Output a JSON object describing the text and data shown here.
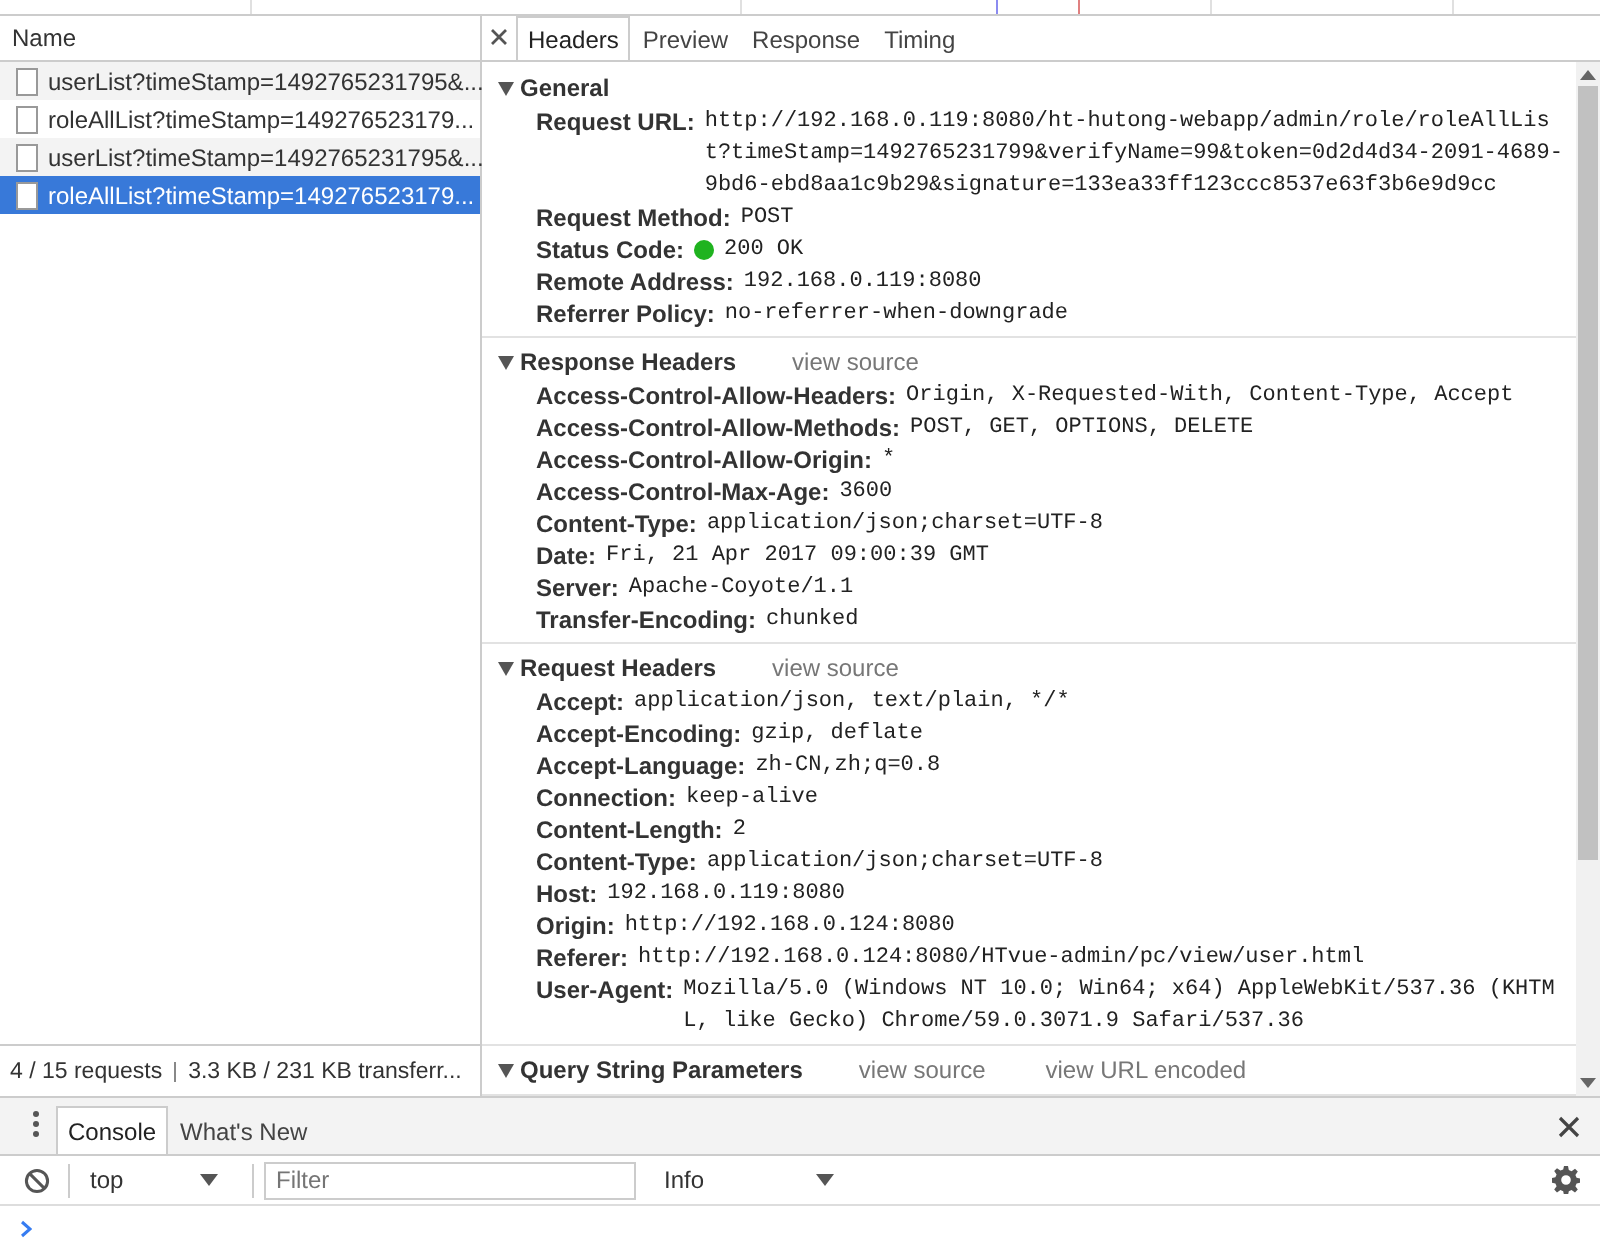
{
  "requests": {
    "column": "Name",
    "items": [
      {
        "label": "userList?timeStamp=1492765231795&...",
        "selected": false
      },
      {
        "label": "roleAllList?timeStamp=149276523179...",
        "selected": false
      },
      {
        "label": "userList?timeStamp=1492765231795&...",
        "selected": false
      },
      {
        "label": "roleAllList?timeStamp=149276523179...",
        "selected": true
      }
    ],
    "summary": {
      "requests": "4 / 15 requests",
      "transferred": "3.3 KB / 231 KB transferr..."
    }
  },
  "detail_tabs": [
    {
      "label": "Headers",
      "selected": true
    },
    {
      "label": "Preview",
      "selected": false
    },
    {
      "label": "Response",
      "selected": false
    },
    {
      "label": "Timing",
      "selected": false
    }
  ],
  "sections": [
    {
      "title": "General",
      "expanded": true,
      "items": [
        {
          "kind": "text",
          "name": "Request URL:",
          "value": "http://192.168.0.119:8080/ht-hutong-webapp/admin/role/roleAllList?timeStamp=1492765231799&verifyName=99&token=0d2d4d34-2091-4689-9bd6-ebd8aa1c9b29&signature=133ea33ff123ccc8537e63f3b6e9d9cc"
        },
        {
          "kind": "text",
          "name": "Request Method:",
          "value": "POST"
        },
        {
          "kind": "status",
          "name": "Status Code:",
          "value": "200 OK",
          "color": "#1fb31f"
        },
        {
          "kind": "text",
          "name": "Remote Address:",
          "value": "192.168.0.119:8080"
        },
        {
          "kind": "text",
          "name": "Referrer Policy:",
          "value": "no-referrer-when-downgrade"
        }
      ]
    },
    {
      "title": "Response Headers",
      "expanded": true,
      "links": [
        "view source"
      ],
      "items": [
        {
          "kind": "text",
          "name": "Access-Control-Allow-Headers:",
          "value": "Origin, X-Requested-With, Content-Type, Accept"
        },
        {
          "kind": "text",
          "name": "Access-Control-Allow-Methods:",
          "value": "POST, GET, OPTIONS, DELETE"
        },
        {
          "kind": "text",
          "name": "Access-Control-Allow-Origin:",
          "value": "*"
        },
        {
          "kind": "text",
          "name": "Access-Control-Max-Age:",
          "value": "3600"
        },
        {
          "kind": "text",
          "name": "Content-Type:",
          "value": "application/json;charset=UTF-8"
        },
        {
          "kind": "text",
          "name": "Date:",
          "value": "Fri, 21 Apr 2017 09:00:39 GMT"
        },
        {
          "kind": "text",
          "name": "Server:",
          "value": "Apache-Coyote/1.1"
        },
        {
          "kind": "text",
          "name": "Transfer-Encoding:",
          "value": "chunked"
        }
      ]
    },
    {
      "title": "Request Headers",
      "expanded": true,
      "links": [
        "view source"
      ],
      "items": [
        {
          "kind": "text",
          "name": "Accept:",
          "value": "application/json, text/plain, */*"
        },
        {
          "kind": "text",
          "name": "Accept-Encoding:",
          "value": "gzip, deflate"
        },
        {
          "kind": "text",
          "name": "Accept-Language:",
          "value": "zh-CN,zh;q=0.8"
        },
        {
          "kind": "text",
          "name": "Connection:",
          "value": "keep-alive"
        },
        {
          "kind": "text",
          "name": "Content-Length:",
          "value": "2"
        },
        {
          "kind": "text",
          "name": "Content-Type:",
          "value": "application/json;charset=UTF-8"
        },
        {
          "kind": "text",
          "name": "Host:",
          "value": "192.168.0.119:8080"
        },
        {
          "kind": "text",
          "name": "Origin:",
          "value": "http://192.168.0.124:8080"
        },
        {
          "kind": "text",
          "name": "Referer:",
          "value": "http://192.168.0.124:8080/HTvue-admin/pc/view/user.html"
        },
        {
          "kind": "text",
          "name": "User-Agent:",
          "value": "Mozilla/5.0 (Windows NT 10.0; Win64; x64) AppleWebKit/537.36 (KHTML, like Gecko) Chrome/59.0.3071.9 Safari/537.36"
        }
      ]
    },
    {
      "title": "Query String Parameters",
      "expanded": true,
      "links": [
        "view source",
        "view URL encoded"
      ]
    }
  ],
  "drawer": {
    "tabs": [
      {
        "label": "Console",
        "selected": true
      },
      {
        "label": "What's New",
        "selected": false
      }
    ],
    "context": "top",
    "filter": {
      "placeholder": "Filter"
    },
    "level": "Info"
  }
}
